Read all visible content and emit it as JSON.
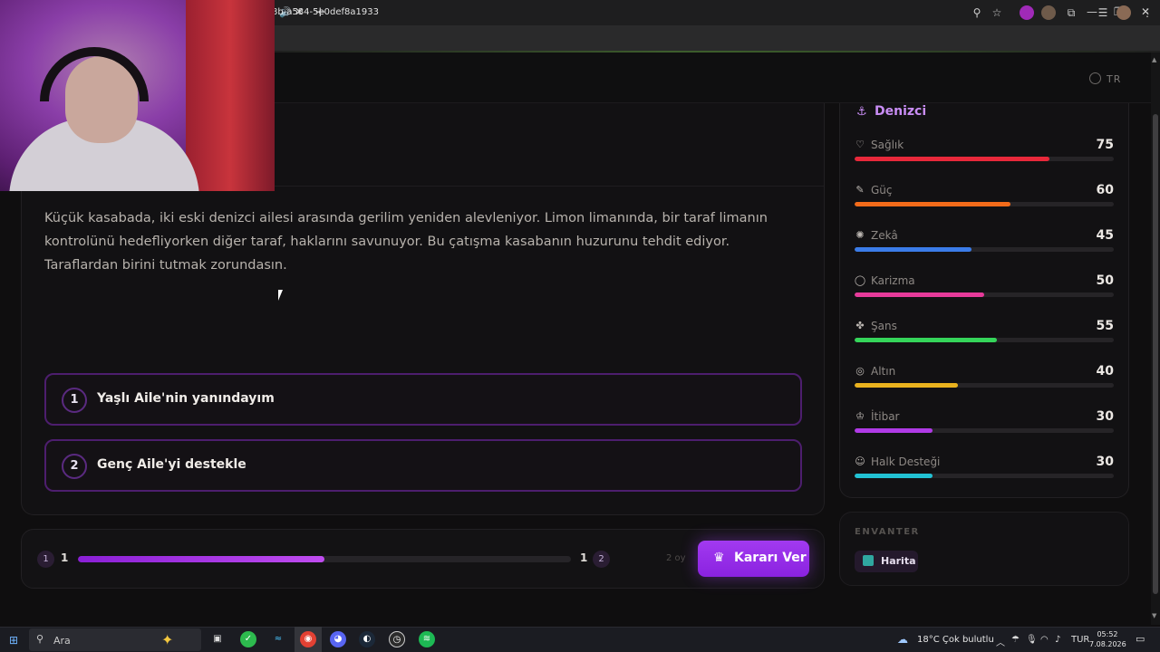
{
  "browser": {
    "url": "8b-a584-5e0def8a1933",
    "sound_icon": "🔊",
    "close_icon": "✕",
    "new_tab_icon": "+",
    "window": {
      "minimize": "—",
      "restore": "❐",
      "close": "✕"
    }
  },
  "app": {
    "language": "TR",
    "story_text": "Küçük kasabada, iki eski denizci ailesi arasında gerilim yeniden alevleniyor. Limon limanında, bir taraf limanın kontrolünü hedefliyorken diğer taraf, haklarını savunuyor. Bu çatışma kasabanın huzurunu tehdit ediyor. Taraflardan birini tutmak zorundasın.",
    "choices": [
      {
        "number": "1",
        "label": "Yaşlı Aile'nin yanındayım"
      },
      {
        "number": "2",
        "label": "Genç Aile'yi destekle"
      }
    ],
    "vote": {
      "left_badge": "1",
      "left_count": "1",
      "right_count": "1",
      "right_badge": "2",
      "progress": 0.5,
      "total": "2 oy",
      "button_label": "Kararı Ver",
      "button_icon": "♛"
    },
    "character": {
      "name": "Denizci",
      "anchor_icon": "⚓",
      "stats": [
        {
          "label": "Sağlık",
          "value": "75",
          "max": 100,
          "color": "#e8283a",
          "icon": "♡"
        },
        {
          "label": "Güç",
          "value": "60",
          "max": 100,
          "color": "#f36b1a",
          "icon": "✎"
        },
        {
          "label": "Zekâ",
          "value": "45",
          "max": 100,
          "color": "#3b7ce8",
          "icon": "✺"
        },
        {
          "label": "Karizma",
          "value": "50",
          "max": 100,
          "color": "#e63a9a",
          "icon": "◯"
        },
        {
          "label": "Şans",
          "value": "55",
          "max": 100,
          "color": "#35d55a",
          "icon": "✤"
        },
        {
          "label": "Altın",
          "value": "40",
          "max": 100,
          "color": "#eab21e",
          "icon": "◎"
        },
        {
          "label": "İtibar",
          "value": "30",
          "max": 100,
          "color": "#b03ae6",
          "icon": "♔"
        },
        {
          "label": "Halk Desteği",
          "value": "30",
          "max": 100,
          "color": "#22c2d4",
          "icon": "☺"
        }
      ]
    },
    "inventory": {
      "title": "ENVANTER",
      "items": [
        {
          "label": "Harita"
        }
      ]
    }
  },
  "taskbar": {
    "search_placeholder": "Ara",
    "weather": "18°C  Çok bulutlu",
    "lang": "TUR",
    "time": "05:52",
    "date": "7.08.2026"
  }
}
